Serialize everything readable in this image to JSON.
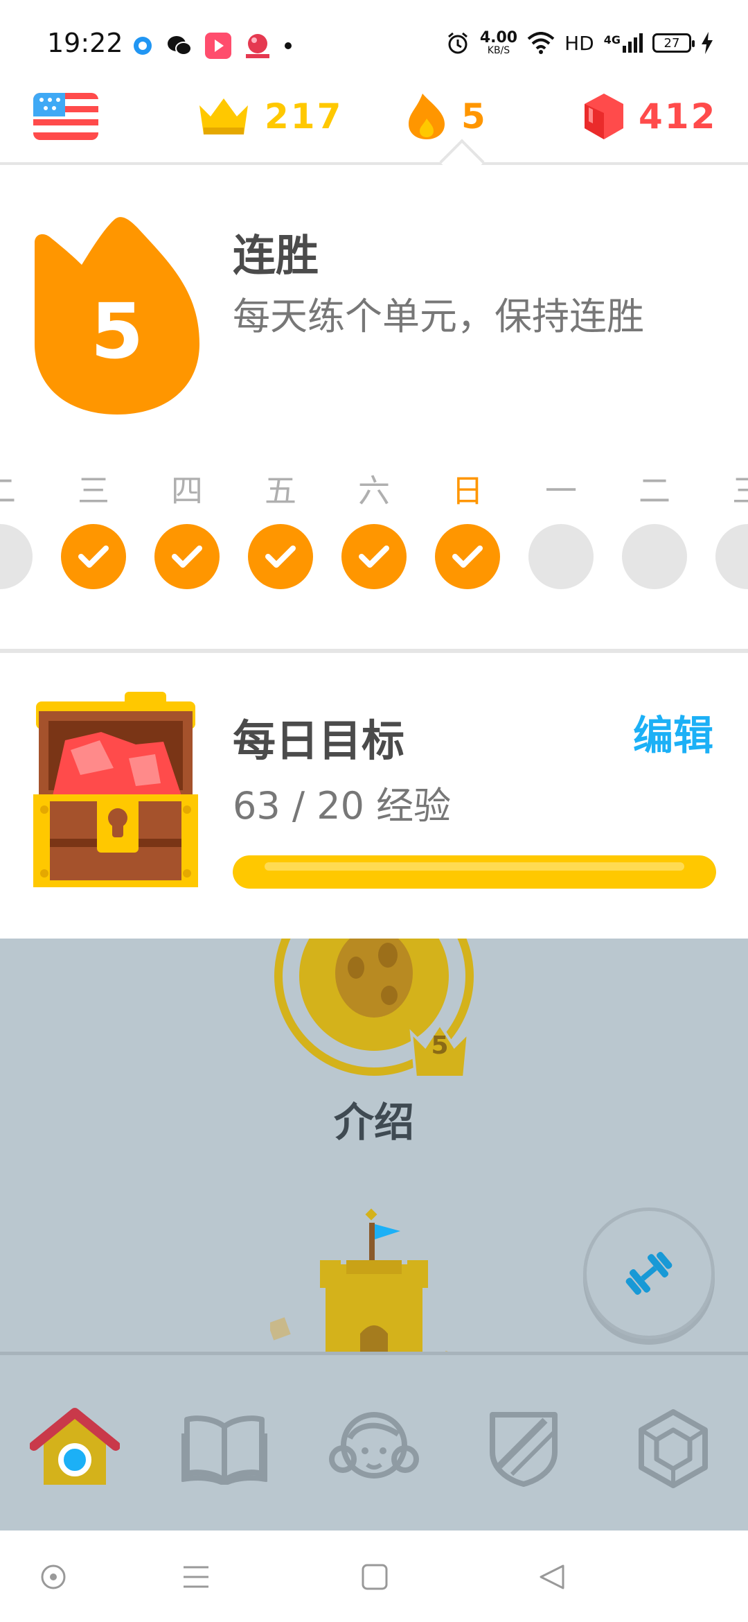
{
  "status_bar": {
    "time": "19:22",
    "speed_value": "4.00",
    "speed_unit": "KB/S",
    "hd_label": "HD",
    "network": "4G",
    "battery": "27"
  },
  "top_stats": {
    "crowns": "217",
    "streak": "5",
    "gems": "412",
    "colors": {
      "crown": "#ffc800",
      "fire": "#ff9600",
      "gem": "#ff4b4b"
    }
  },
  "streak_panel": {
    "count": "5",
    "title": "连胜",
    "description": "每天练个单元，保持连胜",
    "days": [
      {
        "label": "二",
        "done": false,
        "partial": true
      },
      {
        "label": "三",
        "done": true
      },
      {
        "label": "四",
        "done": true
      },
      {
        "label": "五",
        "done": true
      },
      {
        "label": "六",
        "done": true
      },
      {
        "label": "日",
        "done": true,
        "today": true
      },
      {
        "label": "一",
        "done": false
      },
      {
        "label": "二",
        "done": false
      },
      {
        "label": "三",
        "done": false,
        "partial": true
      }
    ]
  },
  "daily_goal": {
    "title": "每日目标",
    "edit_label": "编辑",
    "progress_text": "63 / 20 经验",
    "progress_fraction": 1.0
  },
  "path": {
    "lesson_label": "介绍",
    "lesson_crown_level": "5"
  },
  "tabs": [
    {
      "name": "home",
      "icon": "home-icon",
      "active": true
    },
    {
      "name": "stories",
      "icon": "book-icon"
    },
    {
      "name": "profile",
      "icon": "profile-icon"
    },
    {
      "name": "leaderboards",
      "icon": "shield-icon"
    },
    {
      "name": "shop",
      "icon": "gem-outline-icon"
    }
  ]
}
